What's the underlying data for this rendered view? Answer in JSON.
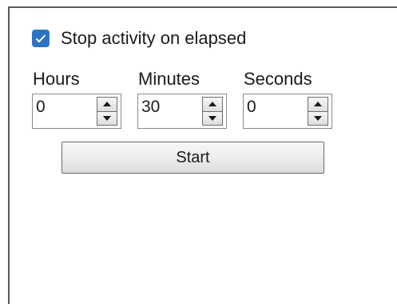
{
  "stop_on_elapsed": {
    "label": "Stop activity on elapsed",
    "checked": true,
    "icon": "checkmark-icon"
  },
  "hours": {
    "label": "Hours",
    "value": "0"
  },
  "minutes": {
    "label": "Minutes",
    "value": "30"
  },
  "seconds": {
    "label": "Seconds",
    "value": "0"
  },
  "start_button": {
    "label": "Start"
  },
  "colors": {
    "checkbox_accent": "#2c73c8"
  },
  "icons": {
    "spin_up": "arrow-up-icon",
    "spin_down": "arrow-down-icon"
  }
}
